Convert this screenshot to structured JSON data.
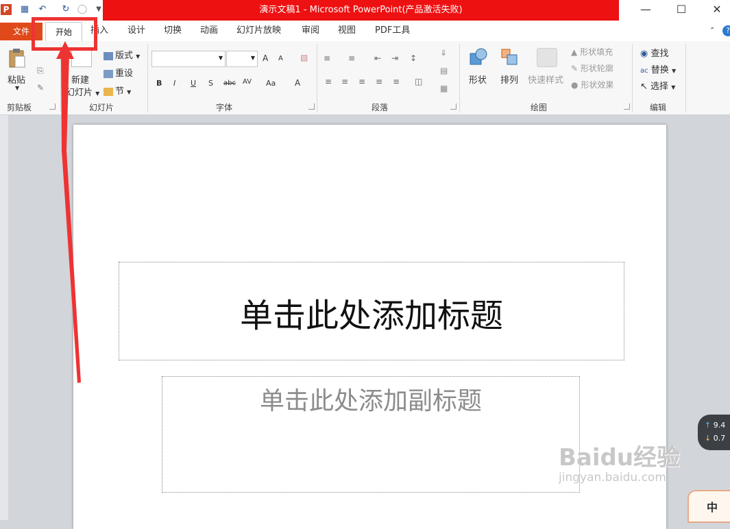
{
  "titlebar": {
    "app_icon": "P",
    "title": "演示文稿1 - Microsoft PowerPoint(产品激活失败)",
    "quick_access": [
      "save-icon",
      "undo-icon",
      "redo-icon",
      "repeat-icon",
      "customize-icon"
    ],
    "accent": "#ee1111"
  },
  "tabs": {
    "file": "文件",
    "items": [
      "开始",
      "插入",
      "设计",
      "切换",
      "动画",
      "幻灯片放映",
      "审阅",
      "视图",
      "PDF工具"
    ],
    "active": "开始"
  },
  "ribbon": {
    "clipboard": {
      "paste": "粘贴",
      "label": "剪贴板"
    },
    "slides": {
      "new_slide_line1": "新建",
      "new_slide_line2": "幻灯片",
      "layout": "版式",
      "reset": "重设",
      "section": "节",
      "label": "幻灯片"
    },
    "font": {
      "label": "字体",
      "buttons": [
        "B",
        "I",
        "U",
        "S",
        "abc",
        "AV",
        "Aa",
        "A"
      ],
      "grow": "A",
      "shrink": "A"
    },
    "paragraph": {
      "label": "段落"
    },
    "drawing": {
      "shapes": "形状",
      "arrange": "排列",
      "quick_styles": "快速样式",
      "shape_fill": "形状填充",
      "shape_outline": "形状轮廓",
      "shape_effects": "形状效果",
      "label": "绘图"
    },
    "editing": {
      "find": "查找",
      "replace": "替换",
      "select": "选择",
      "label": "编辑"
    }
  },
  "slide": {
    "title_placeholder": "单击此处添加标题",
    "subtitle_placeholder": "单击此处添加副标题"
  },
  "speed_widget": {
    "up": "9.4",
    "down": "0.7"
  },
  "watermark": {
    "brand": "Baidu经验",
    "url": "jingyan.baidu.com"
  },
  "corner_badge": "中"
}
